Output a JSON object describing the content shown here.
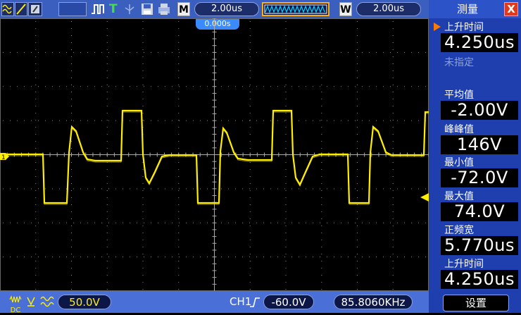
{
  "top_bar": {
    "timebase_label": "M",
    "timebase_value": "2.00us",
    "window_label": "W",
    "window_value": "2.00us",
    "trigger_position": "0.000s"
  },
  "measure_panel": {
    "title": "测量",
    "close_label": "X",
    "items": [
      {
        "label": "上升时间",
        "value": "4.250us"
      },
      {
        "label": "未指定",
        "value": ""
      },
      {
        "label": "平均值",
        "value": "-2.00V"
      },
      {
        "label": "峰峰值",
        "value": "146V"
      },
      {
        "label": "最小值",
        "value": "-72.0V"
      },
      {
        "label": "最大值",
        "value": "74.0V"
      },
      {
        "label": "正频宽",
        "value": "5.770us"
      },
      {
        "label": "上升时间",
        "value": "4.250us"
      }
    ],
    "settings_button": "设置"
  },
  "bottom_bar": {
    "coupling": "DC",
    "ch_scale": "50.0V",
    "trigger_source": "CH1",
    "trigger_level": "-60.0V",
    "frequency": "85.8060KHz"
  },
  "channel_marker": "1",
  "colors": {
    "trace": "#ffee00",
    "topbar": "#3a5fbe",
    "panel": "#1f3fae",
    "accent": "#e03a18"
  }
}
